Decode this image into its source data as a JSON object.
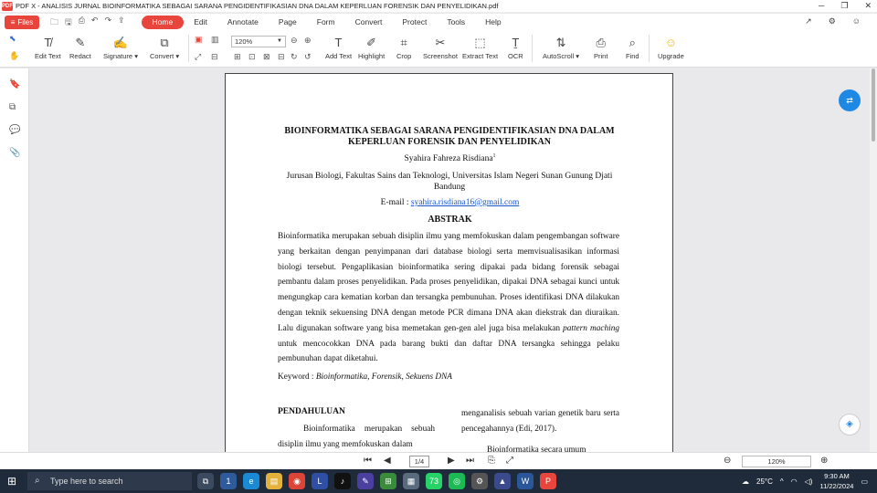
{
  "window": {
    "app_logo": "PDF",
    "title": "PDF X - ANALISIS JURNAL BIOINFORMATIKA SEBAGAI SARANA PENGIDENTIFIKASIAN DNA DALAM KEPERLUAN FORENSIK DAN PENYELIDIKAN.pdf"
  },
  "menubar": {
    "files_label": "Files",
    "items": [
      "Home",
      "Edit",
      "Annotate",
      "Page",
      "Form",
      "Convert",
      "Protect",
      "Tools",
      "Help"
    ],
    "active": "Home"
  },
  "toolbar": {
    "zoom": "120%",
    "tools": {
      "edit_text": "Edit Text",
      "redact": "Redact",
      "signature": "Signature",
      "convert": "Convert",
      "add_text": "Add Text",
      "highlight": "Highlight",
      "crop": "Crop",
      "screenshot": "Screenshot",
      "extract_text": "Extract Text",
      "ocr": "OCR",
      "autoscroll": "AutoScroll",
      "print": "Print",
      "find": "Find",
      "upgrade": "Upgrade"
    }
  },
  "document": {
    "title": "BIOINFORMATIKA SEBAGAI SARANA PENGIDENTIFIKASIAN DNA DALAM KEPERLUAN FORENSIK DAN PENYELIDIKAN",
    "author": "Syahira Fahreza Risdiana",
    "author_sup": "1",
    "affiliation": "Jurusan Biologi, Fakultas Sains dan Teknologi, Universitas Islam Negeri Sunan Gunung Djati Bandung",
    "email_label": "E-mail : ",
    "email": "syahira.risdiana16@gmail.com",
    "abstract_heading": "ABSTRAK",
    "abstract_before": "Bioinformatika merupakan sebuah disiplin ilmu yang memfokuskan dalam pengembangan software yang berkaitan dengan penyimpanan dari database biologi serta memvisualisasikan informasi biologi tersebut. Pengaplikasian bioinformatika sering dipakai pada bidang forensik sebagai pembantu dalam proses penyelidikan. Pada proses penyelidikan, dipakai DNA sebagai kunci untuk mengungkap cara kematian korban dan tersangka pembunuhan. Proses identifikasi DNA dilakukan dengan teknik sekuensing DNA dengan metode PCR dimana DNA akan diekstrak dan diuraikan. Lalu digunakan software yang bisa memetakan gen-gen alel juga bisa melakukan ",
    "abstract_italic": "pattern maching",
    "abstract_after": " untuk mencocokkan DNA pada barang bukti dan daftar DNA tersangka sehingga pelaku pembunuhan dapat diketahui.",
    "keyword_label": "Keyword : ",
    "keywords": "Bioinformatika, Forensik, Sekuens DNA",
    "intro_heading": "PENDAHULUAN",
    "intro_col1": "Bioinformatika merupakan sebuah disiplin ilmu yang memfokuskan dalam",
    "intro_col2a": "menganalisis sebuah varian genetik baru serta pencegahannya (Edi, 2017).",
    "intro_col2b": "Bioinformatika secara umum"
  },
  "statusbar": {
    "page_indicator": "1/4",
    "zoom": "120%"
  },
  "taskbar": {
    "search_placeholder": "Type here to search",
    "temperature": "25°C",
    "time": "9:30 AM",
    "date": "11/22/2024",
    "badge_mail": "1",
    "badge_whatsapp": "73"
  }
}
